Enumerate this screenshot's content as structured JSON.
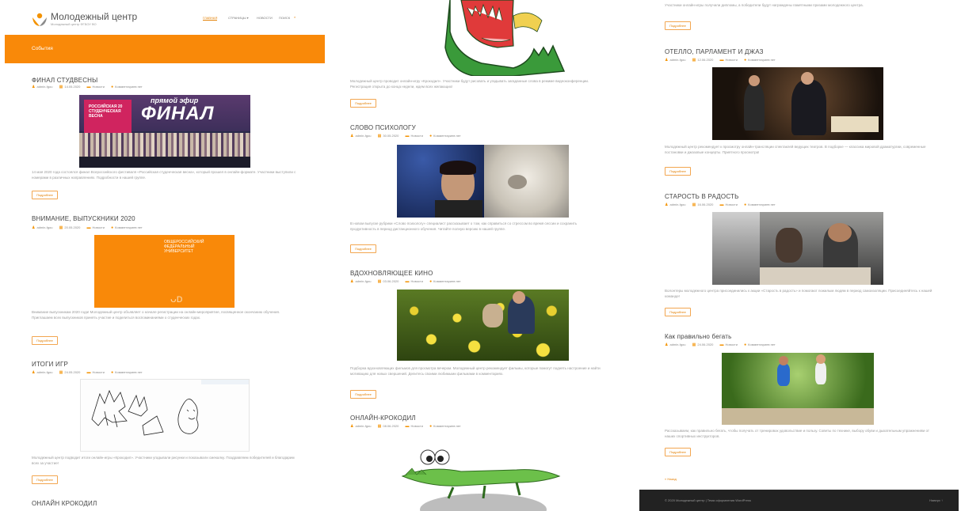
{
  "site": {
    "title": "Молодежный центр",
    "tagline": "Молодежный центр ФГБОУ ВО",
    "nav": [
      {
        "label": "ГЛАВНАЯ",
        "active": true
      },
      {
        "label": "СТРАНИЦЫ ▾",
        "active": false
      },
      {
        "label": "НОВОСТИ",
        "active": false
      },
      {
        "label": "ПОИСК",
        "active": false
      }
    ],
    "banner": "События",
    "accent": "#f98909"
  },
  "read_more": "Подробнее",
  "posts": {
    "final": {
      "title": "ФИНАЛ СТУДВЕСНЫ",
      "meta": [
        "admin-fgou",
        "14.05.2020",
        "Новости",
        "Комментариев нет"
      ],
      "image_text": {
        "line1": "РОССИЙСКАЯ 20",
        "line2": "СТУДЕНЧЕСКАЯ",
        "line3": "ВЕСНА",
        "big": "ФИНАЛ",
        "top": "прямой эфир"
      },
      "excerpt": "14 мая 2020 года состоялся финал Всероссийского фестиваля «Российская студенческая весна», который прошел в онлайн-формате. Участники выступили с номерами в различных направлениях. Подробности в нашей группе."
    },
    "graduates": {
      "title": "ВНИМАНИЕ, ВЫПУСКНИКИ 2020",
      "meta": [
        "admin-fgou",
        "20.05.2020",
        "Новости",
        "Комментариев нет"
      ],
      "image_text": [
        "ОБЩЕРОССИЙСКИЙ",
        "ФЕДЕРАЛЬНЫЙ",
        "УНИВЕРСИТЕТ"
      ],
      "excerpt": "Внимание выпускникам 2020 года! Молодежный центр объявляет о начале регистрации на онлайн-мероприятие, посвященное окончанию обучения. Приглашаем всех выпускников принять участие и поделиться воспоминаниями о студенческих годах."
    },
    "games": {
      "title": "ИТОГИ ИГР",
      "meta": [
        "admin-fgou",
        "24.05.2020",
        "Новости",
        "Комментариев нет"
      ],
      "excerpt": "Молодежный центр подводит итоги онлайн-игры «Крокодил». Участники угадывали рисунки и показывали смекалку. Поздравляем победителей и благодарим всех за участие!"
    },
    "croc_left": {
      "title": "ОНЛАЙН КРОКОДИЛ"
    },
    "croc_top": {
      "excerpt": "Молодежный центр проводит онлайн-игру «Крокодил». Участники будут рисовать и угадывать загаданные слова в режиме видеоконференции. Регистрация открыта до конца недели, ждем всех желающих!"
    },
    "psych": {
      "title": "СЛОВО ПСИХОЛОГУ",
      "meta": [
        "admin-fgou",
        "30.05.2020",
        "Новости",
        "Комментариев нет"
      ],
      "excerpt": "В новом выпуске рубрики «Слово психологу» специалист рассказывает о том, как справиться со стрессом во время сессии и сохранить продуктивность в период дистанционного обучения. Читайте полную версию в нашей группе."
    },
    "cinema": {
      "title": "ВДОХНОВЛЯЮЩЕЕ КИНО",
      "meta": [
        "admin-fgou",
        "03.06.2020",
        "Новости",
        "Комментариев нет"
      ],
      "excerpt": "Подборка вдохновляющих фильмов для просмотра вечером. Молодежный центр рекомендует фильмы, которые помогут поднять настроение и найти мотивацию для новых свершений. Делитесь своими любимыми фильмами в комментариях."
    },
    "croc_online": {
      "title": "ОНЛАЙН-КРОКОДИЛ",
      "meta": [
        "admin-fgou",
        "08.06.2020",
        "Новости",
        "Комментариев нет"
      ]
    },
    "croc_prev": {
      "excerpt": "Участники онлайн-игры получили дипломы, а победители будут награждены памятными призами молодежного центра."
    },
    "othello": {
      "title": "ОТЕЛЛО, ПАРЛАМЕНТ И ДЖАЗ",
      "meta": [
        "admin-fgou",
        "12.06.2020",
        "Новости",
        "Комментариев нет"
      ],
      "excerpt": "Молодежный центр рекомендует к просмотру онлайн-трансляции спектаклей ведущих театров. В подборке — классика мировой драматургии, современные постановки и джазовые концерты. Приятного просмотра!"
    },
    "oldage": {
      "title": "СТАРОСТЬ В РАДОСТЬ",
      "meta": [
        "admin-fgou",
        "16.06.2020",
        "Новости",
        "Комментариев нет"
      ],
      "excerpt": "Волонтеры молодежного центра присоединились к акции «Старость в радость» и помогают пожилым людям в период самоизоляции. Присоединяйтесь к нашей команде!"
    },
    "run": {
      "title": "Как правильно бегать",
      "meta": [
        "admin-fgou",
        "24.06.2020",
        "Новости",
        "Комментариев нет"
      ],
      "excerpt": "Рассказываем, как правильно бегать, чтобы получать от тренировок удовольствие и пользу. Советы по технике, выбору обуви и дыхательным упражнениям от наших спортивных инструкторов."
    }
  },
  "prev_link": "« Назад",
  "footer": {
    "left": "© 2020 Молодежный центр | Тема оформления WordPress",
    "right": "Наверх ↑"
  }
}
